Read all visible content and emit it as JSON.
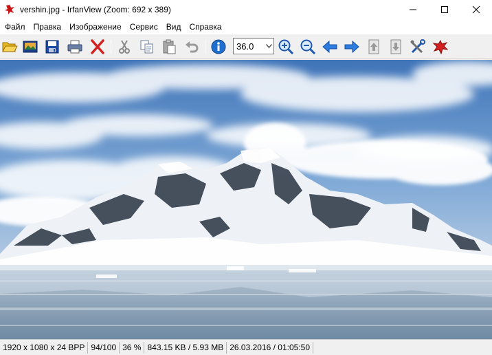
{
  "window": {
    "title": "vershin.jpg - IrfanView (Zoom: 692 x 389)",
    "app_icon": "irfanview-logo-icon"
  },
  "menu": {
    "items": [
      {
        "label": "Файл"
      },
      {
        "label": "Правка"
      },
      {
        "label": "Изображение"
      },
      {
        "label": "Сервис"
      },
      {
        "label": "Вид"
      },
      {
        "label": "Справка"
      }
    ]
  },
  "toolbar": {
    "zoom_value": "36.0",
    "buttons": [
      "open-folder-icon",
      "slideshow-icon",
      "save-icon",
      "print-icon",
      "delete-icon",
      "cut-icon",
      "copy-icon",
      "paste-icon",
      "undo-icon",
      "info-icon",
      "zoom-in-icon",
      "zoom-out-icon",
      "previous-arrow-icon",
      "next-arrow-icon",
      "first-page-icon",
      "last-page-icon",
      "settings-tools-icon",
      "irfanview-cat-icon"
    ]
  },
  "statusbar": {
    "dimensions": "1920 x 1080 x 24 BPP",
    "index": "94/100",
    "zoom": "36 %",
    "size": "843.15 KB / 5.93 MB",
    "datetime": "26.03.2016 / 01:05:50"
  },
  "colors": {
    "sky": "#5b8cc6",
    "water": "#9fb2c4",
    "snow": "#f4f7fb",
    "rock": "#303a48",
    "accent_red": "#d42020",
    "accent_blue": "#1e6fd0"
  }
}
